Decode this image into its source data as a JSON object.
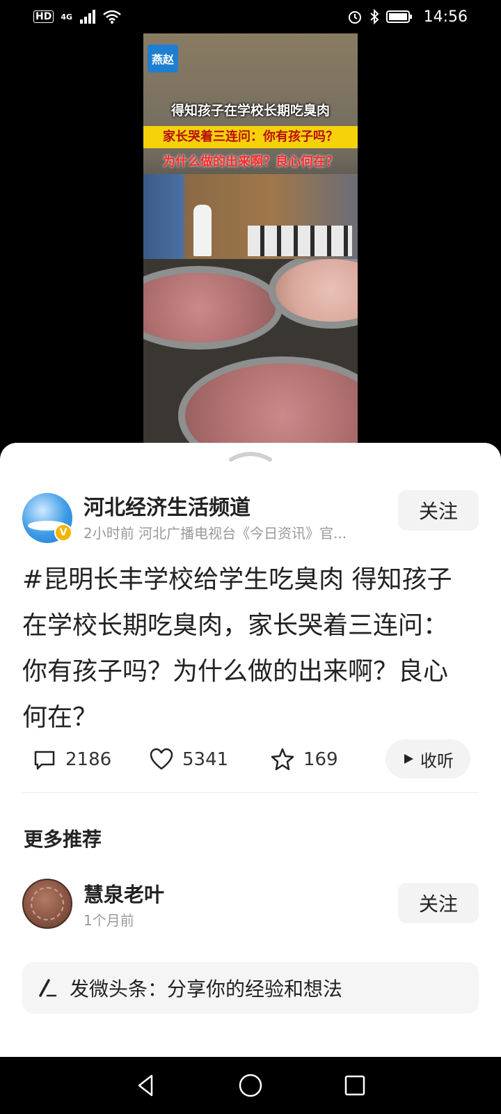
{
  "status_bar": {
    "hd": "HD",
    "network": "4G",
    "time": "14:56"
  },
  "video": {
    "logo_text": "燕赵",
    "headline_1": "得知孩子在学校长期吃臭肉",
    "headline_2": "家长哭着三连问：你有孩子吗？",
    "headline_3": "为什么做的出来啊？良心何在？"
  },
  "author": {
    "name": "河北经济生活频道",
    "meta": "2小时前  河北广播电视台《今日资讯》官...",
    "verified_mark": "V",
    "follow_label": "关注"
  },
  "post": {
    "text": "#昆明长丰学校给学生吃臭肉 得知孩子在学校长期吃臭肉，家长哭着三连问：你有孩子吗？为什么做的出来啊？良心何在？"
  },
  "actions": {
    "comments": "2186",
    "likes": "5341",
    "favorites": "169",
    "listen_label": "收听"
  },
  "more": {
    "title": "更多推荐",
    "recommendation": {
      "name": "慧泉老叶",
      "meta": "1个月前",
      "follow_label": "关注"
    }
  },
  "compose": {
    "placeholder": "发微头条：分享你的经验和想法"
  },
  "icons": {
    "comment": "comment-icon",
    "like": "heart-icon",
    "favorite": "star-icon",
    "play": "play-icon",
    "compose": "pen-icon",
    "back": "back-triangle-icon",
    "home": "home-circle-icon",
    "recents": "recents-square-icon"
  }
}
